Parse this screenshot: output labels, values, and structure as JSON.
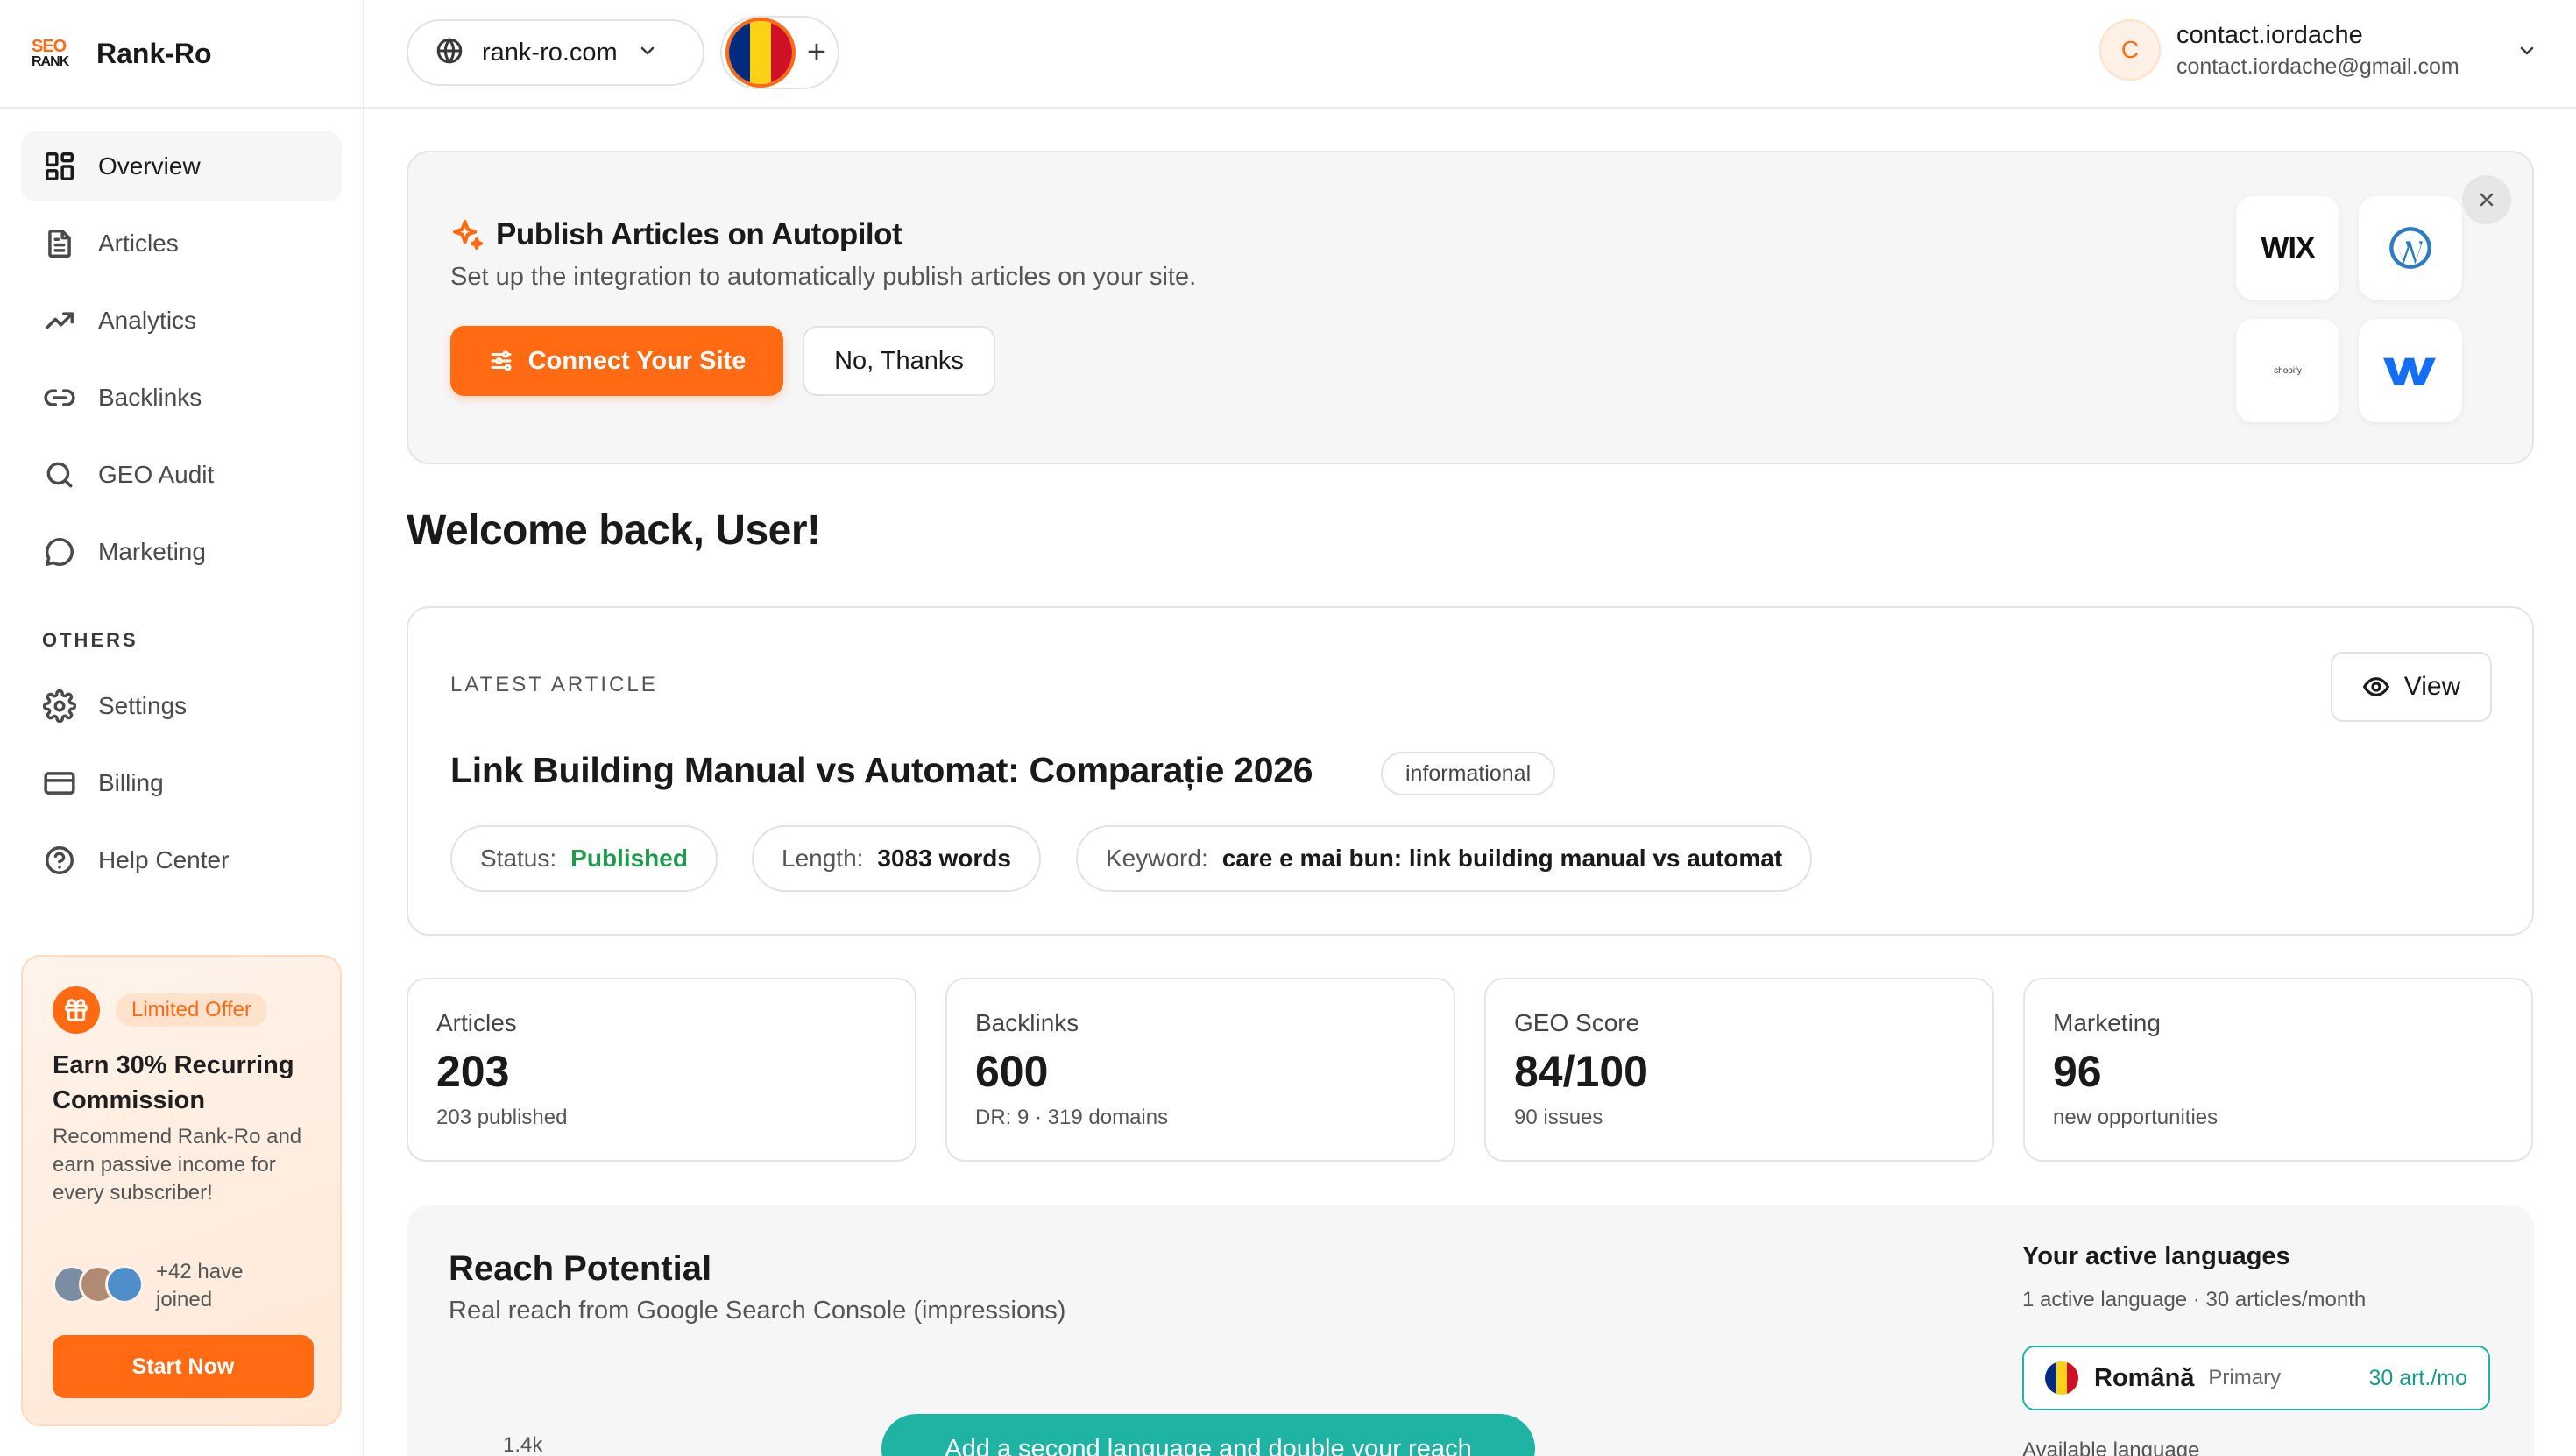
{
  "brand": {
    "logo_top": "SEO",
    "logo_bottom": "RANK",
    "name": "Rank-Ro",
    "accent": "#ff6a13"
  },
  "sidebar": {
    "items": [
      {
        "label": "Overview",
        "icon": "grid-icon",
        "active": true
      },
      {
        "label": "Articles",
        "icon": "document-icon"
      },
      {
        "label": "Analytics",
        "icon": "trend-icon"
      },
      {
        "label": "Backlinks",
        "icon": "link-icon"
      },
      {
        "label": "GEO Audit",
        "icon": "search-icon"
      },
      {
        "label": "Marketing",
        "icon": "chat-icon"
      }
    ],
    "others_heading": "OTHERS",
    "others": [
      {
        "label": "Settings",
        "icon": "gear-icon"
      },
      {
        "label": "Billing",
        "icon": "card-icon"
      },
      {
        "label": "Help Center",
        "icon": "help-icon"
      }
    ]
  },
  "promo": {
    "badge": "Limited Offer",
    "title": "Earn 30% Recurring Commission",
    "text": "Recommend Rank-Ro and earn passive income for every subscriber!",
    "joined": "+42 have joined",
    "button": "Start Now"
  },
  "topbar": {
    "site": "rank-ro.com",
    "add_symbol": "+",
    "user_initial": "C",
    "user_name": "contact.iordache",
    "user_email": "contact.iordache@gmail.com"
  },
  "autopilot": {
    "title": "Publish Articles on Autopilot",
    "subtitle": "Set up the integration to automatically publish articles on your site.",
    "connect_label": "Connect Your Site",
    "decline_label": "No, Thanks",
    "integrations": {
      "wix": "WIX",
      "shopify": "shopify"
    }
  },
  "welcome": "Welcome back, User!",
  "latest_article": {
    "label": "LATEST ARTICLE",
    "view_label": "View",
    "title": "Link Building Manual vs Automat: Comparație 2026",
    "tag": "informational",
    "status_key": "Status:",
    "status_value": "Published",
    "length_key": "Length:",
    "length_value": "3083 words",
    "keyword_key": "Keyword:",
    "keyword_value": "care e mai bun: link building manual vs automat"
  },
  "stats": [
    {
      "label": "Articles",
      "value": "203",
      "sub": "203 published"
    },
    {
      "label": "Backlinks",
      "value": "600",
      "sub": "DR: 9 · 319 domains"
    },
    {
      "label": "GEO Score",
      "value": "84/100",
      "sub": "90 issues"
    },
    {
      "label": "Marketing",
      "value": "96",
      "sub": "new opportunities"
    }
  ],
  "reach": {
    "title": "Reach Potential",
    "subtitle": "Real reach from Google Search Console (impressions)",
    "tick": "1.4k",
    "cta": "Add a second language and double your reach",
    "langs_title": "Your active languages",
    "langs_sub": "1 active language · 30 articles/month",
    "language": {
      "name": "Română",
      "role": "Primary",
      "rate": "30 art./mo"
    },
    "available_label": "Available language"
  },
  "colors": {
    "accent": "#ff6a13",
    "success": "#1f9a4b",
    "teal": "#1fb3a3",
    "flag_ro": [
      "#002b7f",
      "#fcd116",
      "#ce1126"
    ]
  }
}
